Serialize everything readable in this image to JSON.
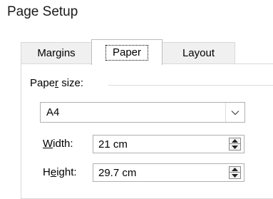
{
  "window": {
    "title": "Page Setup"
  },
  "tabs": [
    {
      "label": "Margins"
    },
    {
      "label": "Paper"
    },
    {
      "label": "Layout"
    }
  ],
  "paper_size": {
    "group_label_pre": "Pape",
    "group_label_key": "r",
    "group_label_post": " size:",
    "value": "A4"
  },
  "width": {
    "label_key": "W",
    "label_rest": "idth:",
    "value": "21 cm"
  },
  "height": {
    "label_pre": "H",
    "label_key": "e",
    "label_post": "ight:",
    "value": "29.7 cm"
  },
  "icons": {
    "dropdown": "chevron-down-icon",
    "spin_up": "spin-up-icon",
    "spin_down": "spin-down-icon"
  }
}
